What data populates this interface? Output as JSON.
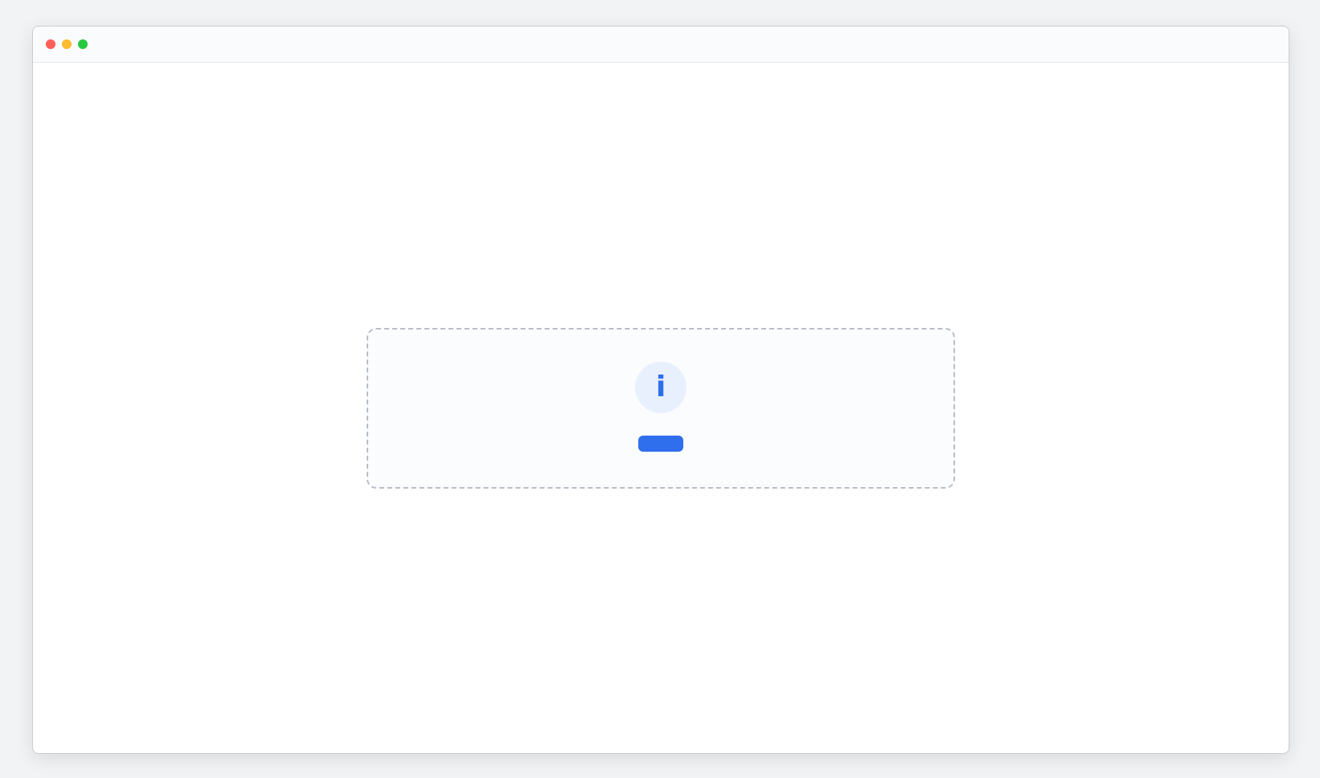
{
  "window": {
    "title": ""
  },
  "notice": {
    "icon_name": "info-icon",
    "icon_glyph": "i",
    "title": "",
    "message": "",
    "action_label": ""
  }
}
